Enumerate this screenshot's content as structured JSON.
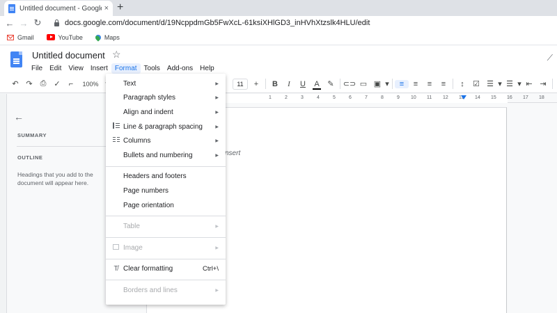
{
  "browser": {
    "tab_title": "Untitled document - Google Docs",
    "tab_close": "×",
    "new_tab": "+",
    "url": "docs.google.com/document/d/19NcppdmGb5FwXcL-61ksiXHlGD3_inHVhXtzslk4HLU/edit",
    "bookmarks": [
      "Gmail",
      "YouTube",
      "Maps"
    ]
  },
  "docs": {
    "title": "Untitled document",
    "menus": [
      "File",
      "Edit",
      "View",
      "Insert",
      "Format",
      "Tools",
      "Add-ons",
      "Help"
    ],
    "active_menu": "Format"
  },
  "toolbar": {
    "zoom": "100%",
    "font_size": "11"
  },
  "outline": {
    "summary_label": "SUMMARY",
    "outline_label": "OUTLINE",
    "hint": "Headings that you add to the document will appear here."
  },
  "ruler": {
    "numbers": [
      "1",
      "2",
      "3",
      "4",
      "5",
      "6",
      "7",
      "8",
      "9",
      "10",
      "11",
      "12",
      "13",
      "14",
      "15",
      "16",
      "17",
      "18"
    ]
  },
  "document": {
    "partial_text": "nsert"
  },
  "format_menu": {
    "text": "Text",
    "paragraph_styles": "Paragraph styles",
    "align_indent": "Align and indent",
    "line_spacing": "Line & paragraph spacing",
    "columns": "Columns",
    "bullets": "Bullets and numbering",
    "headers_footers": "Headers and footers",
    "page_numbers": "Page numbers",
    "page_orientation": "Page orientation",
    "table": "Table",
    "image": "Image",
    "clear_formatting": "Clear formatting",
    "clear_shortcut": "Ctrl+\\",
    "borders_lines": "Borders and lines"
  }
}
